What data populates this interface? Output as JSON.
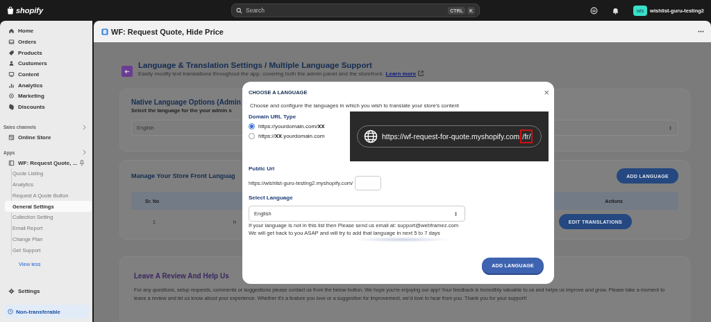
{
  "topbar": {
    "logo": "shopify",
    "search": {
      "placeholder": "Search"
    },
    "shortcut_keys": [
      "CTRL",
      "K"
    ],
    "store_initials": "wis",
    "store_name": "wishlist-guru-testing2"
  },
  "sidebar": {
    "items": [
      {
        "label": "Home",
        "selected": false
      },
      {
        "label": "Orders",
        "selected": false
      },
      {
        "label": "Products",
        "selected": false
      },
      {
        "label": "Customers",
        "selected": false
      },
      {
        "label": "Content",
        "selected": false
      },
      {
        "label": "Analytics",
        "selected": false
      },
      {
        "label": "Marketing",
        "selected": false
      },
      {
        "label": "Discounts",
        "selected": false
      }
    ],
    "sales_channels": {
      "heading": "Sales channels",
      "items": [
        {
          "label": "Online Store",
          "selected": false
        }
      ]
    },
    "apps": {
      "heading": "Apps",
      "items": [
        {
          "label": "WF: Request Quote, ...",
          "selected": false,
          "children": [
            {
              "label": "Quote Listing",
              "selected": false
            },
            {
              "label": "Analytics",
              "selected": false
            },
            {
              "label": "Request A Quote Button",
              "selected": false
            },
            {
              "label": "General Settings",
              "selected": true
            },
            {
              "label": "Collection Setting",
              "selected": false
            },
            {
              "label": "Email Report",
              "selected": false
            },
            {
              "label": "Change Plan",
              "selected": false
            },
            {
              "label": "Get Support",
              "selected": false
            }
          ]
        }
      ],
      "view_less": "View less"
    },
    "settings": {
      "label": "Settings",
      "selected": false
    },
    "badge": "Non-transferable"
  },
  "app_header": {
    "title": "WF: Request Quote, Hide Price"
  },
  "page": {
    "title": "Language & Translation Settings / Multiple Language Support",
    "subtitle": "Easily modify text translations throughout the app, covering both the admin panel and the storefront.",
    "learn_more": "Learn more",
    "native_card": {
      "title": "Native Language Options (Admin",
      "description": "Select the language for the your admin s",
      "select_value": "English"
    },
    "storefront_card": {
      "title": "Manage Your Store Front Languag",
      "add_button": "ADD LANGUAGE",
      "columns": [
        "Sr. No",
        "Actions"
      ],
      "rows": [
        {
          "cells": [
            "1",
            "h"
          ],
          "action": "EDIT TRANSLATIONS"
        }
      ]
    },
    "review_card": {
      "title": "Leave A Review And Help Us",
      "text": "For any questions, setup requests, comments or suggestions please contact us from the below button. We hope you're enjoying our app! Your feedback is incredibly valuable to us and helps us improve and grow. Please take a moment to leave a review and let us know about your experience. Whether it's a feature you love or a suggestion for improvement, we'd love to hear from you. Thank you for your support!"
    }
  },
  "modal": {
    "title": "CHOOSE A LANGUAGE",
    "close": "×",
    "description": "Choose and configure the languages in which you wish to translate your store's content",
    "domain_heading": "Domain URL Type",
    "domain_options": [
      {
        "label": "https://yourdomain.com/**xx**",
        "selected": true
      },
      {
        "label": "https://**xx**.yourdomain.com",
        "selected": false
      }
    ],
    "preview": {
      "url": "https://wf-request-for-quote.myshopify.com",
      "highlight": "/fr/"
    },
    "public_url_heading": "Public Url",
    "public_url_prefix": "https://wishlist-guru-testing2.myshopify.com/",
    "language_heading": "Select Language",
    "language_value": "English",
    "notes": [
      "If your language is not in this list then Please send us email at: support@webframez.com",
      "We will get back to you ASAP and will try to add that language in next 5 to 7 days"
    ],
    "submit": "ADD LANGUAGE"
  }
}
